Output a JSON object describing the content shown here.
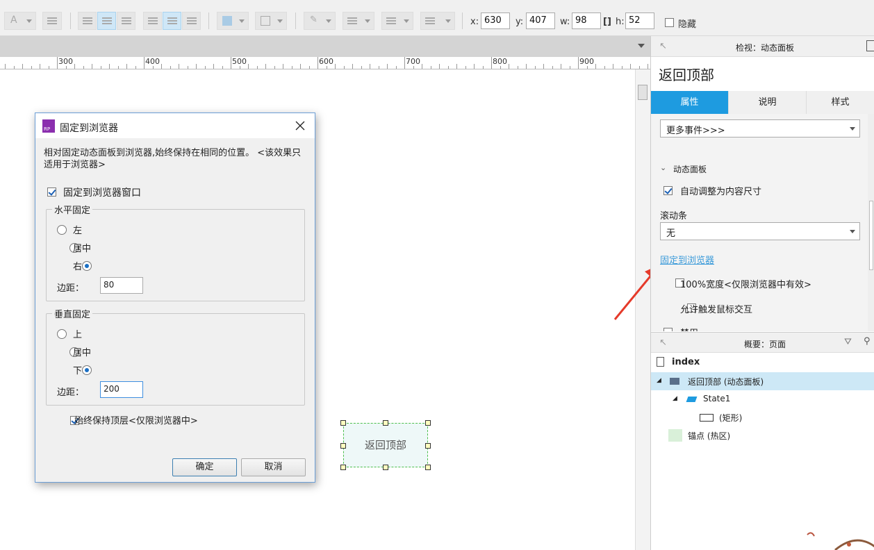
{
  "toolbar": {
    "x_label": "x:",
    "x_value": "630",
    "y_label": "y:",
    "y_value": "407",
    "w_label": "w:",
    "w_value": "98",
    "h_label": "h:",
    "h_value": "52",
    "hide_label": "隐藏"
  },
  "ruler": {
    "ticks": [
      "300",
      "400",
      "500",
      "600",
      "700",
      "800",
      "900"
    ]
  },
  "dialog": {
    "title": "固定到浏览器",
    "app_icon_text": "RP",
    "desc": "相对固定动态面板到浏览器,始终保持在相同的位置。 <该效果只适用于浏览器>",
    "pin_label": "固定到浏览器窗口",
    "h_group": "水平固定",
    "h_left": "左",
    "h_center": "居中",
    "h_right": "右",
    "h_margin_label": "边距：",
    "h_margin_value": "80",
    "v_group": "垂直固定",
    "v_top": "上",
    "v_center": "居中",
    "v_bottom": "下",
    "v_margin_label": "边距：",
    "v_margin_value": "200",
    "keep_top_label": "始终保持顶层<仅限浏览器中>",
    "ok": "确定",
    "cancel": "取消"
  },
  "widget": {
    "label": "返回顶部"
  },
  "inspector": {
    "header": "检视：动态面板",
    "name": "返回顶部",
    "tabs": [
      "属性",
      "说明",
      "样式"
    ],
    "events_select": "更多事件>>>",
    "section": "动态面板",
    "auto_fit_label": "自动调整为内容尺寸",
    "scrollbar_label": "滚动条",
    "scrollbar_value": "无",
    "pin_link": "固定到浏览器",
    "full_width_label": "100%宽度<仅限浏览器中有效>",
    "mouse_label": "允许触发鼠标交互",
    "partial_label": "禁用"
  },
  "outline": {
    "header": "概要：页面",
    "page": "index",
    "items": [
      "返回顶部 (动态面板)",
      "State1",
      "(矩形)",
      "锚点 (热区)"
    ]
  },
  "colors": {
    "accent": "#1e9be0",
    "link": "#3a9ad9",
    "arrow": "#e53a2a"
  }
}
